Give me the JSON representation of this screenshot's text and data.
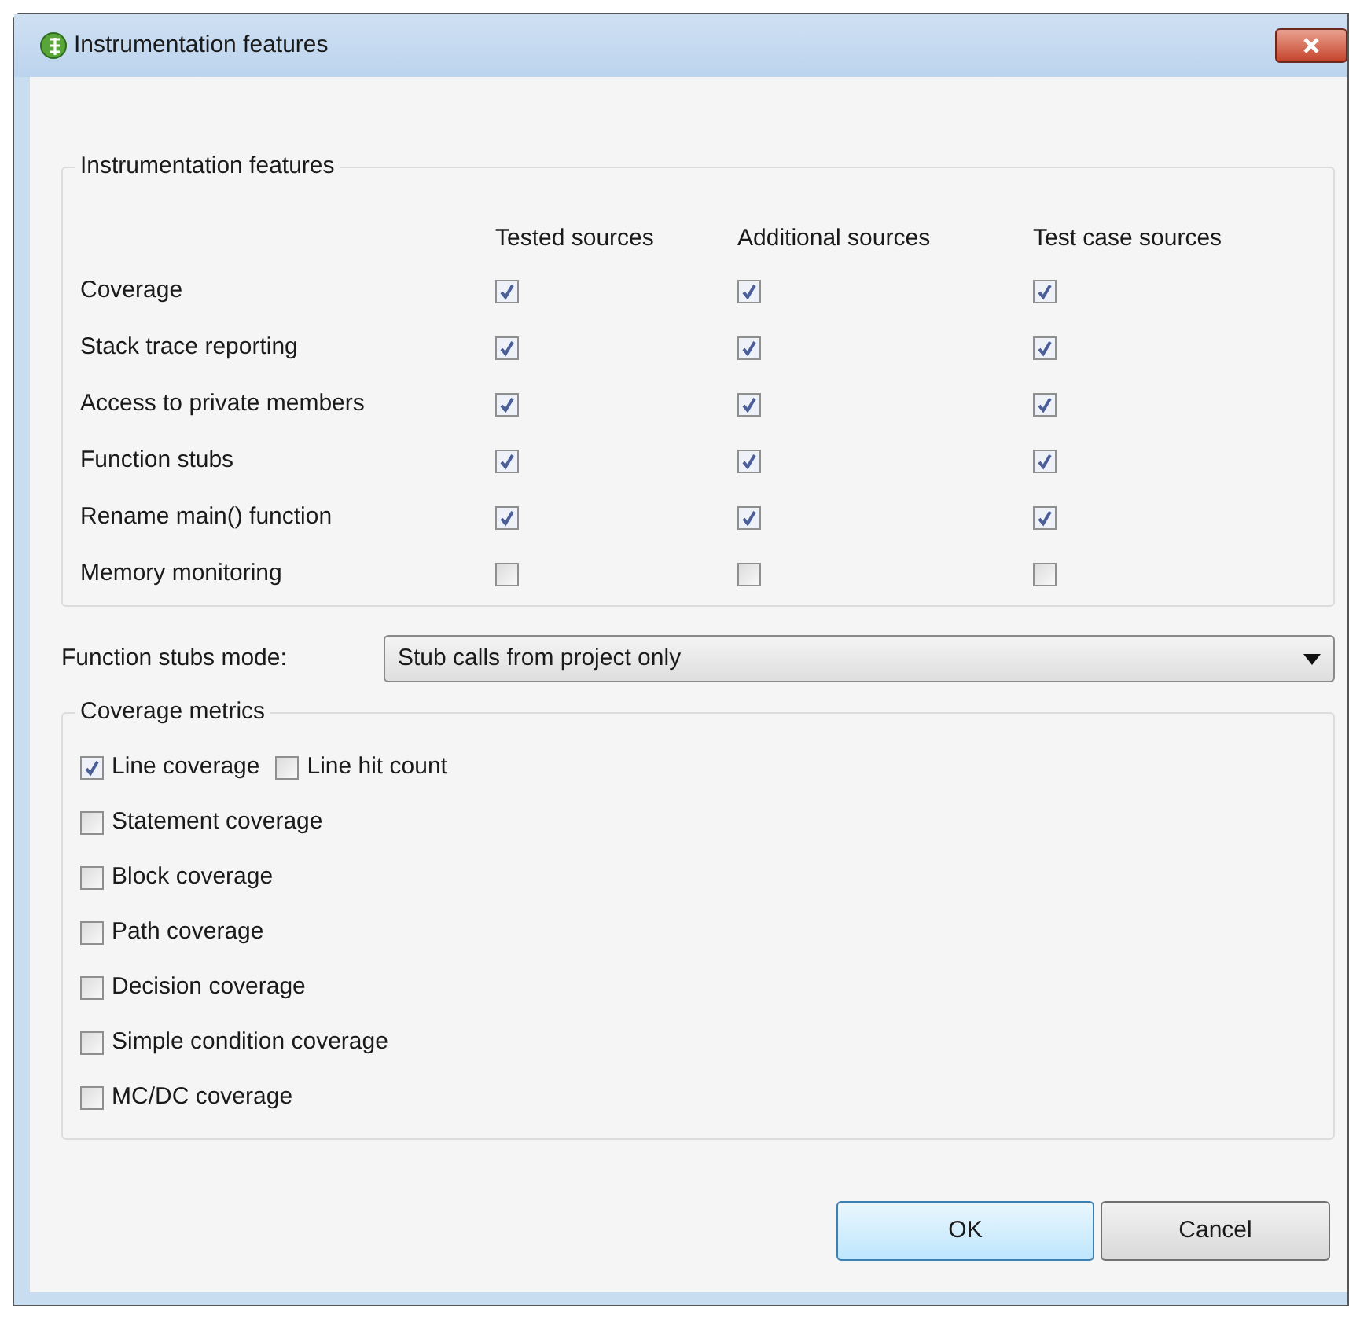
{
  "window": {
    "title": "Instrumentation features"
  },
  "features": {
    "legend": "Instrumentation features",
    "columns": [
      "Tested sources",
      "Additional sources",
      "Test case sources"
    ],
    "rows": [
      {
        "label": "Coverage",
        "checks": [
          true,
          true,
          true
        ]
      },
      {
        "label": "Stack trace reporting",
        "checks": [
          true,
          true,
          true
        ]
      },
      {
        "label": "Access to private members",
        "checks": [
          true,
          true,
          true
        ]
      },
      {
        "label": "Function stubs",
        "checks": [
          true,
          true,
          true
        ]
      },
      {
        "label": "Rename main() function",
        "checks": [
          true,
          true,
          true
        ]
      },
      {
        "label": "Memory monitoring",
        "checks": [
          false,
          false,
          false
        ]
      }
    ]
  },
  "stubs_mode": {
    "label": "Function stubs mode:",
    "value": "Stub calls from project only"
  },
  "coverage_metrics": {
    "legend": "Coverage metrics",
    "rows": [
      [
        {
          "label": "Line coverage",
          "checked": true
        },
        {
          "label": "Line hit count",
          "checked": false
        }
      ],
      [
        {
          "label": "Statement coverage",
          "checked": false
        }
      ],
      [
        {
          "label": "Block coverage",
          "checked": false
        }
      ],
      [
        {
          "label": "Path coverage",
          "checked": false
        }
      ],
      [
        {
          "label": "Decision coverage",
          "checked": false
        }
      ],
      [
        {
          "label": "Simple condition coverage",
          "checked": false
        }
      ],
      [
        {
          "label": "MC/DC coverage",
          "checked": false
        }
      ]
    ]
  },
  "buttons": [
    "OK",
    "Cancel"
  ]
}
